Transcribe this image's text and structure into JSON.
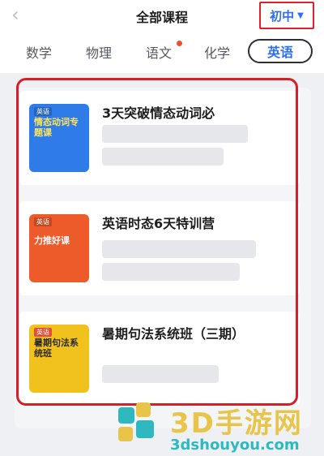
{
  "header": {
    "back_icon": "chevron-left-icon",
    "title": "全部课程",
    "grade": "初中",
    "grade_caret": "caret-down-icon"
  },
  "tabs": [
    {
      "label": "数学",
      "active": false
    },
    {
      "label": "物理",
      "active": false
    },
    {
      "label": "语文",
      "active": false,
      "hot": true
    },
    {
      "label": "化学",
      "active": false
    },
    {
      "label": "英语",
      "active": true
    }
  ],
  "courses": [
    {
      "title": "3天突破情态动词必",
      "thumb_tag": "英语",
      "thumb_text": "情态动词专题课",
      "thumb_color": "#2f7ce8"
    },
    {
      "title": "英语时态6天特训营",
      "thumb_tag": "英语",
      "thumb_text": "力推好课",
      "thumb_color": "#ee5b2a"
    },
    {
      "title": "暑期句法系统班（三期）",
      "thumb_tag": "英语",
      "thumb_text": "暑期句法系统班",
      "thumb_color": "#f1c21e"
    }
  ],
  "watermark": {
    "name": "3D手游网",
    "url": "3dshouyou.com"
  },
  "colors": {
    "accent": "#2f6ff2",
    "highlight": "#d81e28"
  }
}
